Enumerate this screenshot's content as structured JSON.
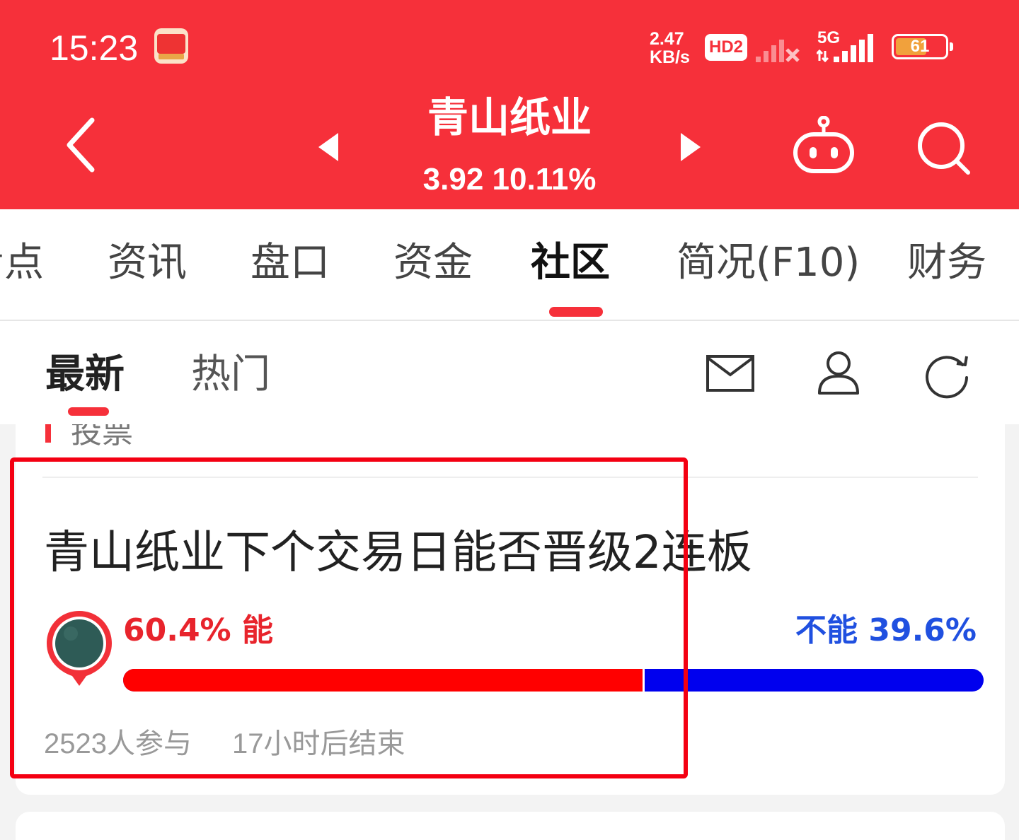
{
  "status_bar": {
    "time": "15:23",
    "speed_value": "2.47",
    "speed_unit": "KB/s",
    "hd_badge": "HD2",
    "network": "5G",
    "battery_level": "61",
    "app_icon": "stock-app-icon"
  },
  "header": {
    "stock_name": "青山纸业",
    "price": "3.92",
    "change_pct": "10.11%",
    "back_icon": "back-arrow-icon",
    "prev_icon": "prev-stock-triangle-icon",
    "next_icon": "next-stock-triangle-icon",
    "robot_icon": "ai-robot-icon",
    "search_icon": "search-icon"
  },
  "tabs": [
    {
      "label": "看点"
    },
    {
      "label": "资讯"
    },
    {
      "label": "盘口"
    },
    {
      "label": "资金"
    },
    {
      "label": "社区",
      "active": true
    },
    {
      "label": "简况(F10)"
    },
    {
      "label": "财务"
    }
  ],
  "subtabs": {
    "latest": "最新",
    "hot": "热门",
    "mail_icon": "mail-icon",
    "user_icon": "user-icon",
    "refresh_icon": "refresh-icon"
  },
  "poll": {
    "section_label": "投票",
    "question": "青山纸业下个交易日能否晋级2连板",
    "yes_label": "60.4% 能",
    "no_label": "不能 39.6%",
    "yes_fraction": 0.604,
    "no_fraction": 0.396,
    "participants": "2523人参与",
    "deadline": "17小时后结束"
  },
  "colors": {
    "brand_red": "#f6303a",
    "yes_red": "#ff0000",
    "no_blue": "#0000ee",
    "highlight": "#f40012"
  }
}
